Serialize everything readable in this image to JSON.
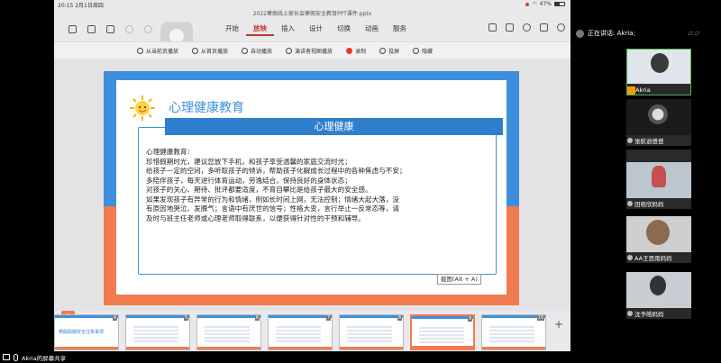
{
  "status_bar": {
    "time": "20:15",
    "date": "2月1日周四",
    "battery": "47%"
  },
  "document": {
    "title": "2022寒假线上家长会寒假安全教育PPT课件.pptx"
  },
  "menu": {
    "tabs": [
      {
        "label": "开始",
        "active": false
      },
      {
        "label": "插入",
        "active": false
      },
      {
        "label": "设计",
        "active": false
      },
      {
        "label": "切换",
        "active": false
      },
      {
        "label": "动画",
        "active": false
      },
      {
        "label": "放映",
        "active": true
      }
    ]
  },
  "ribbon": {
    "items": [
      {
        "label": "从当前页播放",
        "icon": "play-current-icon"
      },
      {
        "label": "从首页播放",
        "icon": "play-first-icon"
      },
      {
        "label": "自动播放",
        "icon": "autoplay-icon"
      },
      {
        "label": "演讲者视图播放",
        "icon": "presenter-view-icon"
      },
      {
        "label": "录制",
        "icon": "record-icon"
      },
      {
        "label": "投屏",
        "icon": "cast-icon"
      },
      {
        "label": "隐藏",
        "icon": "hide-icon"
      }
    ]
  },
  "slide": {
    "title": "心理健康教育",
    "header_box": "心理健康",
    "lines": [
      "心理健康教育：",
      "珍惜假期时光，建议您放下手机，和孩子享受温馨的家庭交流时光；",
      "给孩子一定的空间，多听取孩子的倾诉，帮助孩子化解成长过程中的各种焦虑与不安；",
      "多陪伴孩子，每天进行体育运动，劳逸结合，保持良好的身体状态；",
      "对孩子的关心、期待、批评都要适度，不育目攀比是给孩子最大的安全感。",
      "如果发现孩子有异常的行为和情绪，例如长时间上网，无法控制；情绪大起大落，没",
      "有原因地哭泣、发脾气；言语中有厌世的信号；性格大变，言行举止一反常态等，请",
      "及时与班主任老师或心理老师取得联系，以便获得针对性的干预和辅导。"
    ]
  },
  "tooltip": "截图(Alt + A)",
  "thumbnails": [
    {
      "num": "4",
      "text": "寒假假期安全注意事项"
    },
    {
      "num": "5",
      "text": ""
    },
    {
      "num": "6",
      "text": ""
    },
    {
      "num": "7",
      "text": ""
    },
    {
      "num": "8",
      "text": ""
    },
    {
      "num": "9",
      "text": ""
    },
    {
      "num": "10",
      "text": ""
    }
  ],
  "meeting": {
    "speaking_label": "正在讲话: Akria;",
    "share_label": "Akria的屏幕共享",
    "participants": [
      {
        "name": "Akria"
      },
      {
        "name": "张航逍爸爸"
      },
      {
        "name": ""
      },
      {
        "name": "田晗欣妈妈"
      },
      {
        "name": "AA王思雨妈妈"
      },
      {
        "name": "沈予皓妈妈"
      }
    ]
  }
}
